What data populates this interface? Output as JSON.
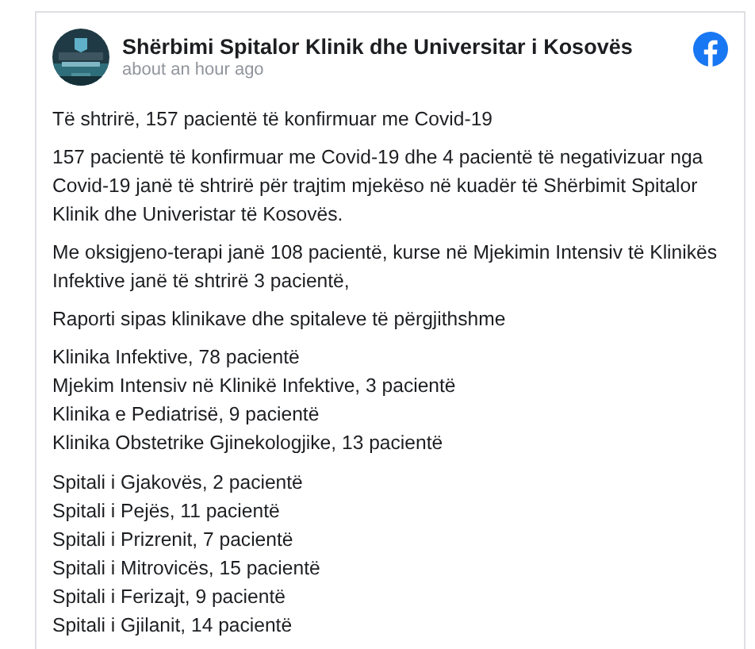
{
  "post": {
    "page_name": "Shërbimi Spitalor Klinik dhe Universitar i Kosovës",
    "time": "about an hour ago",
    "body": [
      {
        "kind": "paragraph",
        "text": "Të shtrirë, 157 pacientë të konfirmuar me Covid-19"
      },
      {
        "kind": "paragraph",
        "text": "157 pacientë të konfirmuar me Covid-19 dhe 4 pacientë të negativizuar nga Covid-19 janë të shtrirë për trajtim mjekëso në kuadër të Shërbimit Spitalor Klinik dhe Univeristar të Kosovës."
      },
      {
        "kind": "paragraph",
        "text": "Me oksigjeno-terapi janë 108 pacientë, kurse në Mjekimin Intensiv të Klinikës Infektive janë të shtrirë 3 pacientë,"
      },
      {
        "kind": "paragraph",
        "text": "Raporti sipas klinikave dhe spitaleve të përgjithshme"
      },
      {
        "kind": "lines",
        "lines": [
          "Klinika Infektive, 78 pacientë",
          "Mjekim Intensiv në Klinikë Infektive, 3 pacientë",
          "Klinika e Pediatrisë, 9 pacientë",
          "Klinika Obstetrike Gjinekologjike, 13 pacientë"
        ]
      },
      {
        "kind": "lines",
        "lines": [
          "Spitali i Gjakovës, 2 pacientë",
          "Spitali i Pejës, 11 pacientë",
          "Spitali i Prizrenit, 7 pacientë",
          "Spitali i Mitrovicës, 15 pacientë",
          "Spitali i Ferizajt, 9 pacientë",
          "Spitali i Gjilanit, 14 pacientë"
        ]
      }
    ]
  }
}
